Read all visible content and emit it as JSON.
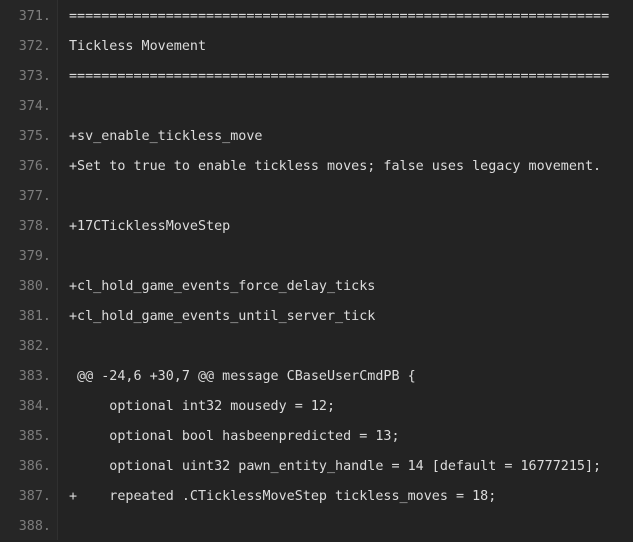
{
  "lines": [
    {
      "number": "371.",
      "text": "==================================================================="
    },
    {
      "number": "372.",
      "text": "Tickless Movement"
    },
    {
      "number": "373.",
      "text": "==================================================================="
    },
    {
      "number": "374.",
      "text": ""
    },
    {
      "number": "375.",
      "text": "+sv_enable_tickless_move"
    },
    {
      "number": "376.",
      "text": "+Set to true to enable tickless moves; false uses legacy movement."
    },
    {
      "number": "377.",
      "text": ""
    },
    {
      "number": "378.",
      "text": "+17CTicklessMoveStep"
    },
    {
      "number": "379.",
      "text": ""
    },
    {
      "number": "380.",
      "text": "+cl_hold_game_events_force_delay_ticks"
    },
    {
      "number": "381.",
      "text": "+cl_hold_game_events_until_server_tick"
    },
    {
      "number": "382.",
      "text": ""
    },
    {
      "number": "383.",
      "text": " @@ -24,6 +30,7 @@ message CBaseUserCmdPB {"
    },
    {
      "number": "384.",
      "text": "     optional int32 mousedy = 12;"
    },
    {
      "number": "385.",
      "text": "     optional bool hasbeenpredicted = 13;"
    },
    {
      "number": "386.",
      "text": "     optional uint32 pawn_entity_handle = 14 [default = 16777215];"
    },
    {
      "number": "387.",
      "text": "+    repeated .CTicklessMoveStep tickless_moves = 18;"
    },
    {
      "number": "388.",
      "text": ""
    }
  ]
}
